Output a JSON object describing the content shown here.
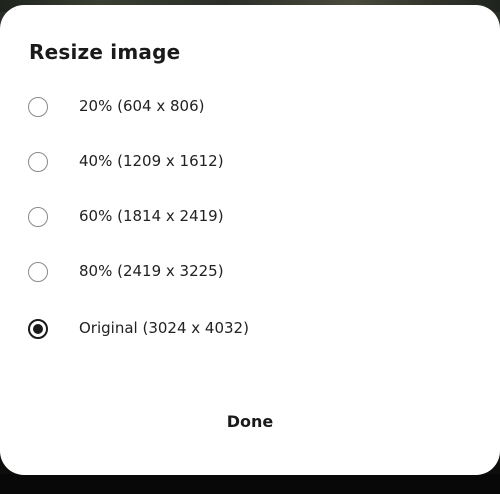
{
  "dialog": {
    "title": "Resize image",
    "options": [
      {
        "label": "20% (604 x 806)",
        "selected": false
      },
      {
        "label": "40% (1209 x 1612)",
        "selected": false
      },
      {
        "label": "60% (1814 x 2419)",
        "selected": false
      },
      {
        "label": "80% (2419 x 3225)",
        "selected": false
      },
      {
        "label": "Original (3024 x 4032)",
        "selected": true
      }
    ],
    "done_label": "Done"
  }
}
